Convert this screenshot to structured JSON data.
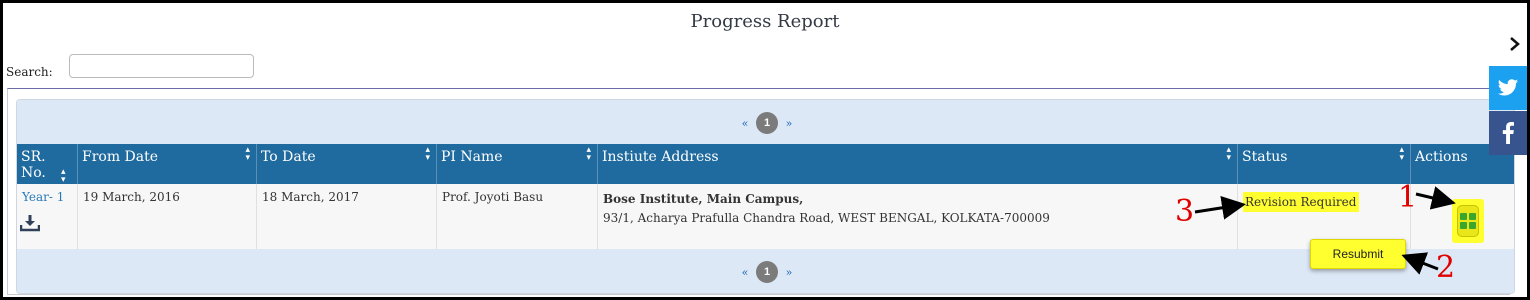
{
  "page": {
    "title": "Progress Report"
  },
  "search": {
    "label": "Search:",
    "value": "",
    "placeholder": ""
  },
  "pagination": {
    "prev": "«",
    "current": "1",
    "next": "»"
  },
  "table": {
    "headers": [
      "SR. No.",
      "From Date",
      "To Date",
      "PI Name",
      "Instiute Address",
      "Status",
      "Actions"
    ],
    "rows": [
      {
        "sr_no": "Year- 1",
        "from_date": "19 March, 2016",
        "to_date": "18 March, 2017",
        "pi_name": "Prof. Joyoti Basu",
        "address_line1": "Bose Institute, Main Campus,",
        "address_line2": "93/1, Acharya Prafulla Chandra Road, WEST BENGAL, KOLKATA-700009",
        "status": "Revision Required"
      }
    ]
  },
  "actions_menu": {
    "resubmit_label": "Resubmit"
  },
  "callouts": [
    "1",
    "2",
    "3"
  ],
  "social": {
    "twitter_icon": "twitter-icon",
    "facebook_icon": "facebook-icon"
  },
  "colors": {
    "header_bg": "#1f6a9e",
    "highlight": "#ffff30",
    "callout": "#e00000",
    "twitter": "#1ca1f1",
    "facebook": "#38548e",
    "action_grid": "#3aa72c"
  }
}
